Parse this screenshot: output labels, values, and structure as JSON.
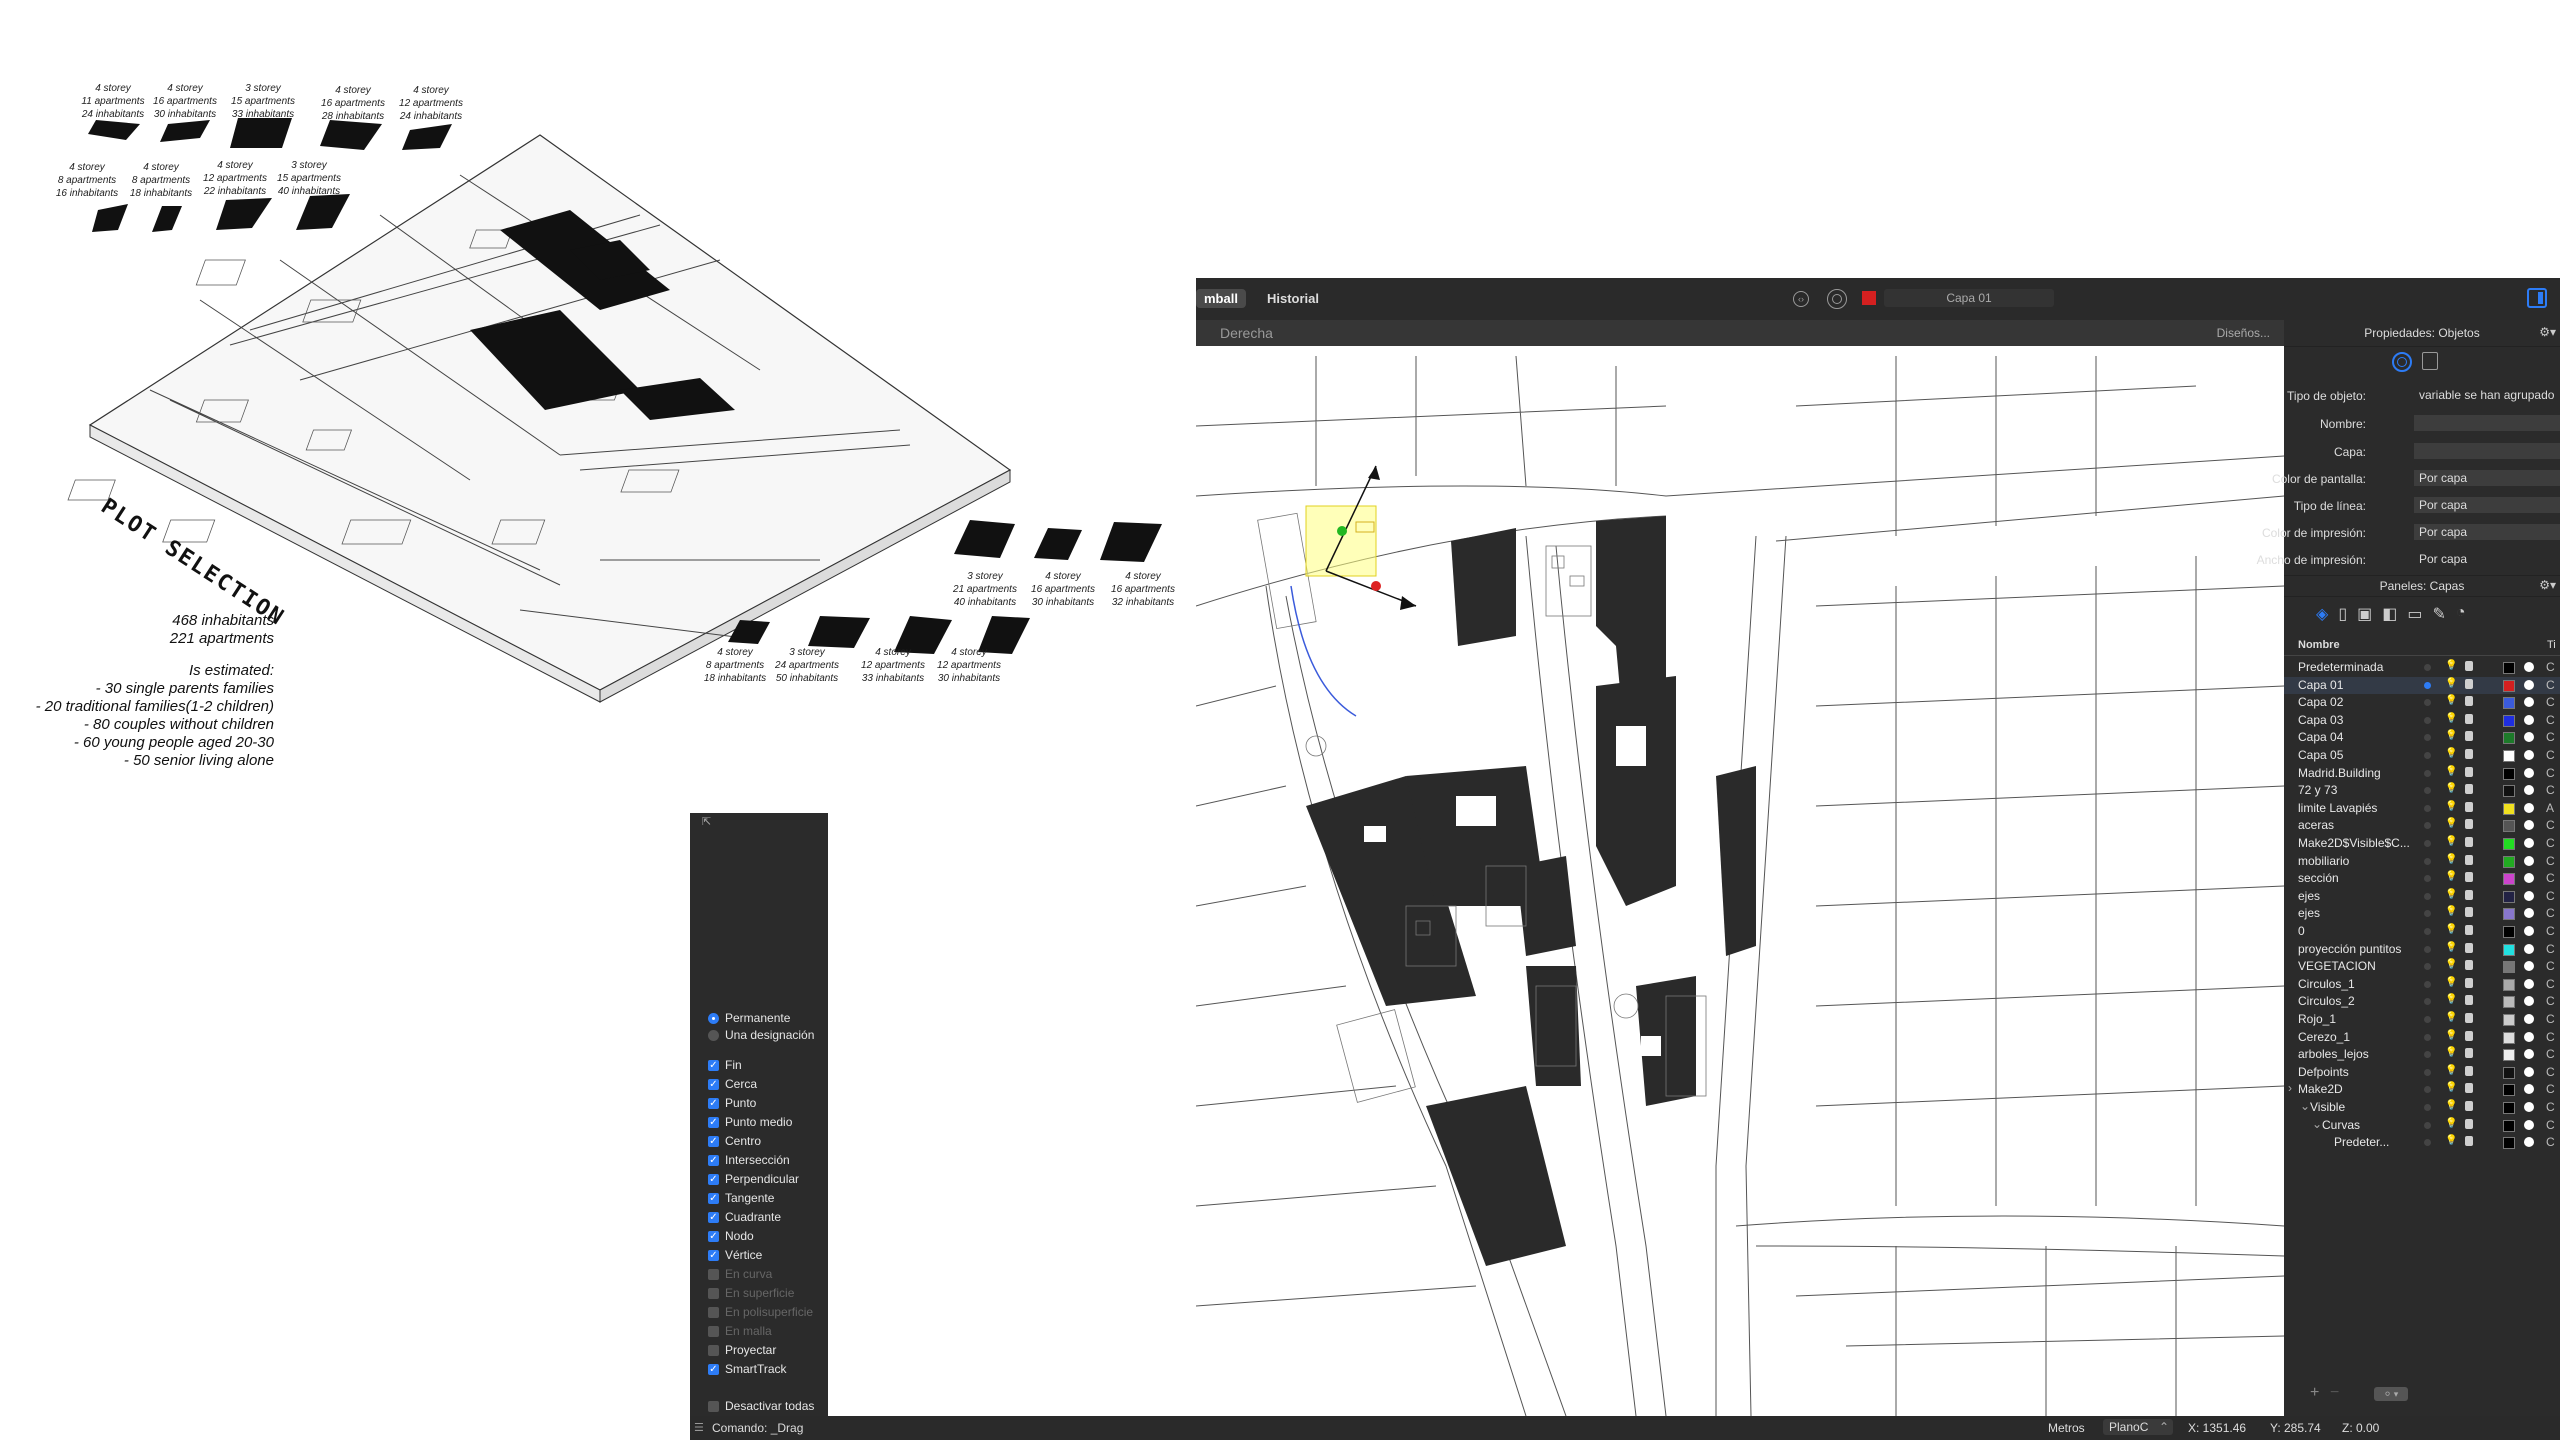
{
  "board": {
    "units_top": [
      {
        "storey": "4 storey",
        "apartments": "11 apartments",
        "inhabitants": "24 inhabitants"
      },
      {
        "storey": "4 storey",
        "apartments": "16 apartments",
        "inhabitants": "30 inhabitants"
      },
      {
        "storey": "3 storey",
        "apartments": "15 apartments",
        "inhabitants": "33 inhabitants"
      },
      {
        "storey": "4 storey",
        "apartments": "16 apartments",
        "inhabitants": "28 inhabitants"
      },
      {
        "storey": "4 storey",
        "apartments": "12 apartments",
        "inhabitants": "24 inhabitants"
      }
    ],
    "units_second": [
      {
        "storey": "4 storey",
        "apartments": "8 apartments",
        "inhabitants": "16 inhabitants"
      },
      {
        "storey": "4 storey",
        "apartments": "8 apartments",
        "inhabitants": "18 inhabitants"
      },
      {
        "storey": "4 storey",
        "apartments": "12 apartments",
        "inhabitants": "22 inhabitants"
      },
      {
        "storey": "3 storey",
        "apartments": "15 apartments",
        "inhabitants": "40 inhabitants"
      }
    ],
    "units_right_top": [
      {
        "storey": "3 storey",
        "apartments": "21 apartments",
        "inhabitants": "40 inhabitants"
      },
      {
        "storey": "4 storey",
        "apartments": "16 apartments",
        "inhabitants": "30 inhabitants"
      },
      {
        "storey": "4 storey",
        "apartments": "16 apartments",
        "inhabitants": "32 inhabitants"
      }
    ],
    "units_right_bottom": [
      {
        "storey": "4 storey",
        "apartments": "8 apartments",
        "inhabitants": "18 inhabitants"
      },
      {
        "storey": "3 storey",
        "apartments": "24 apartments",
        "inhabitants": "50 inhabitants"
      },
      {
        "storey": "4 storey",
        "apartments": "12 apartments",
        "inhabitants": "33 inhabitants"
      },
      {
        "storey": "4 storey",
        "apartments": "12 apartments",
        "inhabitants": "30 inhabitants"
      }
    ],
    "plot_title": "PLOT SELECTION",
    "stats": {
      "inhabitants": "468 inhabitants",
      "apartments": "221 apartments",
      "heading": "Is estimated:",
      "lines": [
        "- 30 single parents families",
        "- 20 traditional families(1-2 children)",
        "- 80 couples without children",
        "- 60 young people aged 20-30",
        "- 50 senior living alone"
      ]
    }
  },
  "rhino": {
    "tabs": {
      "gumball": "mball",
      "history": "Historial"
    },
    "current_layer": "Capa 01",
    "viewport_name": "Derecha",
    "layouts_label": "Diseños...",
    "properties": {
      "title": "Propiedades: Objetos",
      "rows": [
        {
          "label": "Tipo de objeto:",
          "value": "variable se han agrupado"
        },
        {
          "label": "Nombre:",
          "value": ""
        },
        {
          "label": "Capa:",
          "value": ""
        },
        {
          "label": "Color de pantalla:",
          "value": "Por capa"
        },
        {
          "label": "Tipo de línea:",
          "value": "Por capa"
        },
        {
          "label": "Color de impresión:",
          "value": "Por capa"
        },
        {
          "label": "Ancho de impresión:",
          "value": "Por capa"
        }
      ]
    },
    "layers": {
      "title": "Paneles: Capas",
      "header_name": "Nombre",
      "header_cut": "Ti",
      "items": [
        {
          "name": "Predeterminada",
          "color": "#000000",
          "cut": "C"
        },
        {
          "name": "Capa 01",
          "color": "#d42020",
          "cut": "C",
          "current": true
        },
        {
          "name": "Capa 02",
          "color": "#3b5bdb",
          "cut": "C"
        },
        {
          "name": "Capa 03",
          "color": "#1f2ee0",
          "cut": "C"
        },
        {
          "name": "Capa 04",
          "color": "#1d7a2a",
          "cut": "C"
        },
        {
          "name": "Capa 05",
          "color": "#ffffff",
          "cut": "C"
        },
        {
          "name": "Madrid.Building",
          "color": "#000000",
          "cut": "C"
        },
        {
          "name": "72 y 73",
          "color": "#111111",
          "cut": "C"
        },
        {
          "name": "limite Lavapiés",
          "color": "#f0e020",
          "cut": "A"
        },
        {
          "name": "aceras",
          "color": "#555555",
          "cut": "C"
        },
        {
          "name": "Make2D$Visible$C...",
          "color": "#22dd22",
          "cut": "C"
        },
        {
          "name": "mobiliario",
          "color": "#22aa22",
          "cut": "C"
        },
        {
          "name": "sección",
          "color": "#cc44cc",
          "cut": "C"
        },
        {
          "name": "ejes",
          "color": "#222244",
          "cut": "C"
        },
        {
          "name": "ejes",
          "color": "#8877cc",
          "cut": "C"
        },
        {
          "name": "0",
          "color": "#000000",
          "cut": "C"
        },
        {
          "name": "proyección puntitos",
          "color": "#22e0e0",
          "cut": "C"
        },
        {
          "name": "VEGETACION",
          "color": "#777777",
          "cut": "C"
        },
        {
          "name": "Circulos_1",
          "color": "#aaaaaa",
          "cut": "C"
        },
        {
          "name": "Circulos_2",
          "color": "#bbbbbb",
          "cut": "C"
        },
        {
          "name": "Rojo_1",
          "color": "#cccccc",
          "cut": "C"
        },
        {
          "name": "Cerezo_1",
          "color": "#dddddd",
          "cut": "C"
        },
        {
          "name": "arboles_lejos",
          "color": "#eeeeee",
          "cut": "C"
        },
        {
          "name": "Defpoints",
          "color": "#111111",
          "cut": "C"
        },
        {
          "name": "Make2D",
          "color": "#000000",
          "cut": "C",
          "indent": 0,
          "expander": "›"
        },
        {
          "name": "Visible",
          "color": "#000000",
          "cut": "C",
          "indent": 1,
          "expander": "⌄"
        },
        {
          "name": "Curvas",
          "color": "#000000",
          "cut": "C",
          "indent": 2,
          "expander": "⌄"
        },
        {
          "name": "Predeter...",
          "color": "#000000",
          "cut": "C",
          "indent": 3
        }
      ]
    },
    "osnap": {
      "modes": [
        {
          "label": "Permanente",
          "selected": true
        },
        {
          "label": "Una designación",
          "selected": false
        }
      ],
      "snaps": [
        {
          "label": "Fin",
          "checked": true,
          "enabled": true
        },
        {
          "label": "Cerca",
          "checked": true,
          "enabled": true
        },
        {
          "label": "Punto",
          "checked": true,
          "enabled": true
        },
        {
          "label": "Punto medio",
          "checked": true,
          "enabled": true
        },
        {
          "label": "Centro",
          "checked": true,
          "enabled": true
        },
        {
          "label": "Intersección",
          "checked": true,
          "enabled": true
        },
        {
          "label": "Perpendicular",
          "checked": true,
          "enabled": true
        },
        {
          "label": "Tangente",
          "checked": true,
          "enabled": true
        },
        {
          "label": "Cuadrante",
          "checked": true,
          "enabled": true
        },
        {
          "label": "Nodo",
          "checked": true,
          "enabled": true
        },
        {
          "label": "Vértice",
          "checked": true,
          "enabled": true
        },
        {
          "label": "En curva",
          "checked": false,
          "enabled": false
        },
        {
          "label": "En superficie",
          "checked": false,
          "enabled": false
        },
        {
          "label": "En polisuperficie",
          "checked": false,
          "enabled": false
        },
        {
          "label": "En malla",
          "checked": false,
          "enabled": false
        },
        {
          "label": "Proyectar",
          "checked": false,
          "enabled": true
        },
        {
          "label": "SmartTrack",
          "checked": true,
          "enabled": true
        }
      ],
      "disable_all": "Desactivar todas"
    },
    "status": {
      "command": "Comando: _Drag",
      "units": "Metros",
      "cplane": "PlanoC",
      "x": "X: 1351.46",
      "y": "Y: 285.74",
      "z": "Z: 0.00"
    }
  }
}
